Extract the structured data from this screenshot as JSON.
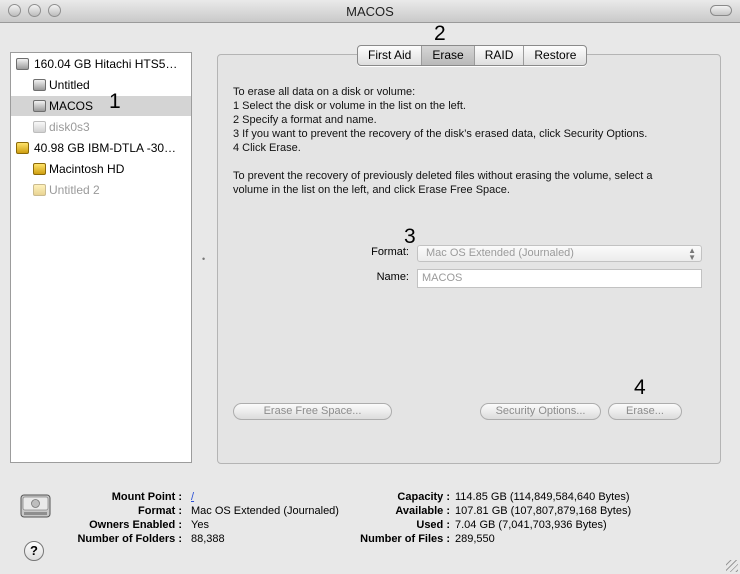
{
  "window": {
    "title": "MACOS"
  },
  "sidebar": {
    "items": [
      {
        "label": "160.04 GB Hitachi HTS5…"
      },
      {
        "label": "Untitled"
      },
      {
        "label": "MACOS"
      },
      {
        "label": "disk0s3"
      },
      {
        "label": "40.98 GB IBM-DTLA -30…"
      },
      {
        "label": "Macintosh HD"
      },
      {
        "label": "Untitled 2"
      }
    ]
  },
  "tabs": [
    {
      "label": "First Aid"
    },
    {
      "label": "Erase"
    },
    {
      "label": "RAID"
    },
    {
      "label": "Restore"
    }
  ],
  "instructions": {
    "line1": "To erase all data on a disk or volume:",
    "line2": "1 Select the disk or volume in the list on the left.",
    "line3": "2 Specify a format and name.",
    "line4": "3 If you want to prevent the recovery of the disk’s erased data, click Security Options.",
    "line5": "4 Click Erase.",
    "line6": "To prevent the recovery of previously deleted files without erasing the volume, select a",
    "line7": "volume in the list on the left, and click Erase Free Space."
  },
  "form": {
    "format_label": "Format:",
    "format_value": "Mac OS Extended (Journaled)",
    "name_label": "Name:",
    "name_value": "MACOS"
  },
  "buttons": {
    "erase_free_space": "Erase Free Space...",
    "security_options": "Security Options...",
    "erase": "Erase..."
  },
  "annotations": {
    "n1": "1",
    "n2": "2",
    "n3": "3",
    "n4": "4"
  },
  "footer": {
    "mount_point_label": "Mount Point :",
    "mount_point_value": "/",
    "format_label": "Format :",
    "format_value": "Mac OS Extended (Journaled)",
    "owners_label": "Owners Enabled :",
    "owners_value": "Yes",
    "folders_label": "Number of Folders :",
    "folders_value": "88,388",
    "capacity_label": "Capacity :",
    "capacity_value": "114.85 GB (114,849,584,640 Bytes)",
    "available_label": "Available :",
    "available_value": "107.81 GB (107,807,879,168 Bytes)",
    "used_label": "Used :",
    "used_value": "7.04 GB (7,041,703,936 Bytes)",
    "files_label": "Number of Files :",
    "files_value": "289,550",
    "help_glyph": "?"
  },
  "icons": {
    "disk": "hard-disk-icon",
    "help": "help-icon"
  }
}
